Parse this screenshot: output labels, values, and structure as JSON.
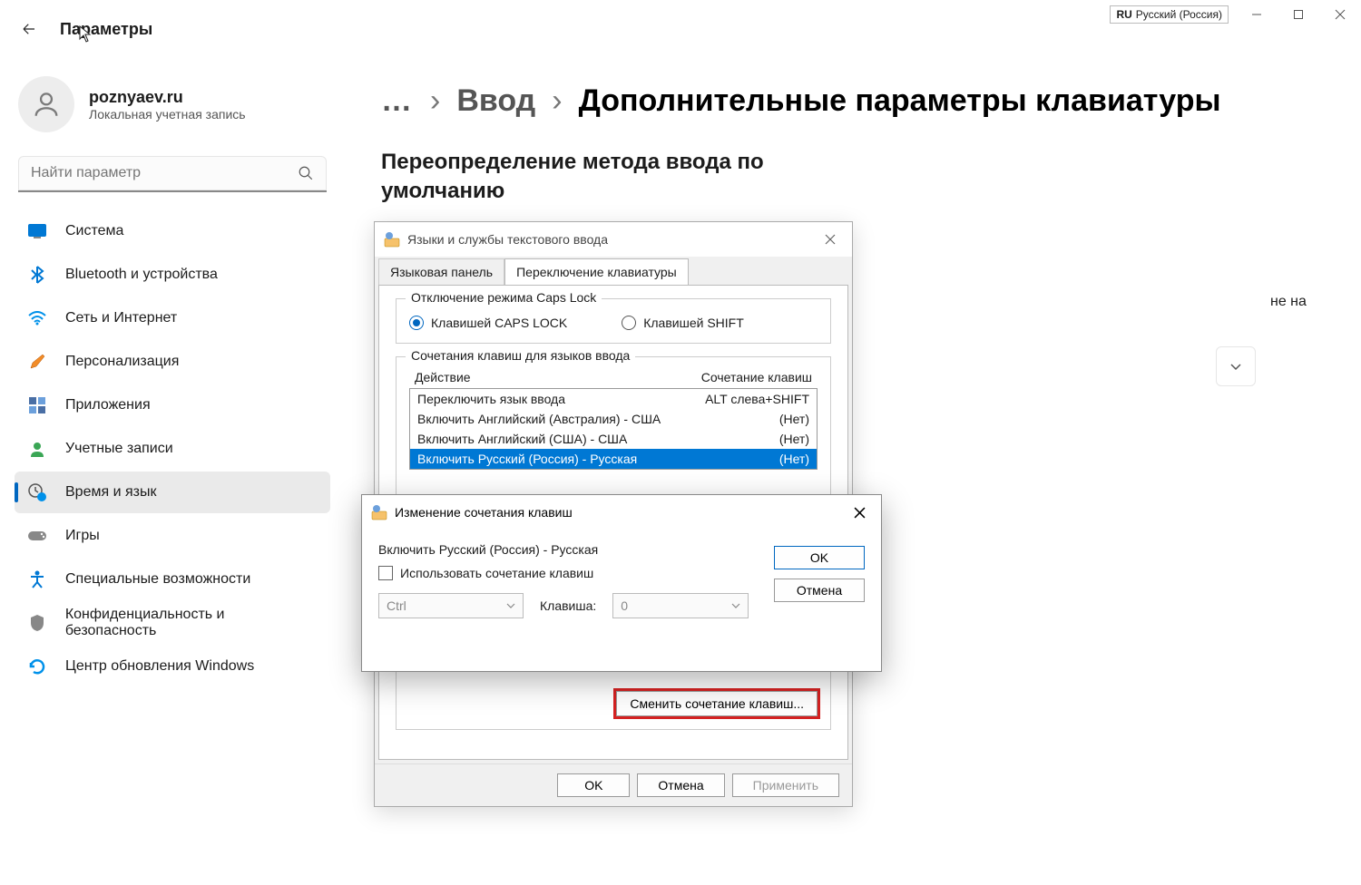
{
  "titlebar": {
    "lang_code": "RU",
    "lang_name": "Русский (Россия)"
  },
  "header": {
    "app_title": "Параметры"
  },
  "profile": {
    "name": "poznyaev.ru",
    "subtitle": "Локальная учетная запись"
  },
  "search": {
    "placeholder": "Найти параметр"
  },
  "nav": {
    "system": "Система",
    "bluetooth": "Bluetooth и устройства",
    "network": "Сеть и Интернет",
    "personalization": "Персонализация",
    "apps": "Приложения",
    "accounts": "Учетные записи",
    "time": "Время и язык",
    "gaming": "Игры",
    "accessibility": "Специальные возможности",
    "privacy": "Конфиденциальность и безопасность",
    "update": "Центр обновления Windows"
  },
  "breadcrumb": {
    "more": "…",
    "link": "Ввод",
    "current": "Дополнительные параметры клавиатуры"
  },
  "section": {
    "title": "Переопределение метода ввода по умолчанию"
  },
  "bg": {
    "hint_suffix": "не на"
  },
  "dlg1": {
    "title": "Языки и службы текстового ввода",
    "tab1": "Языковая панель",
    "tab2": "Переключение клавиатуры",
    "legend1": "Отключение режима Caps Lock",
    "radio1": "Клавишей CAPS LOCK",
    "radio2": "Клавишей SHIFT",
    "legend2": "Сочетания клавиш для языков ввода",
    "col_action": "Действие",
    "col_keys": "Сочетание клавиш",
    "rows": [
      {
        "action": "Переключить язык ввода",
        "keys": "ALT слева+SHIFT"
      },
      {
        "action": "Включить Английский (Австралия) - США",
        "keys": "(Нет)"
      },
      {
        "action": "Включить Английский (США) - США",
        "keys": "(Нет)"
      },
      {
        "action": "Включить Русский (Россия) - Русская",
        "keys": "(Нет)"
      }
    ],
    "change_btn": "Сменить сочетание клавиш...",
    "ok": "OK",
    "cancel": "Отмена",
    "apply": "Применить"
  },
  "dlg2": {
    "title": "Изменение сочетания клавиш",
    "subtitle": "Включить Русский (Россия) - Русская",
    "checkbox": "Использовать сочетание клавиш",
    "modifier": "Ctrl",
    "key_label": "Клавиша:",
    "key_value": "0",
    "ok": "OK",
    "cancel": "Отмена"
  }
}
